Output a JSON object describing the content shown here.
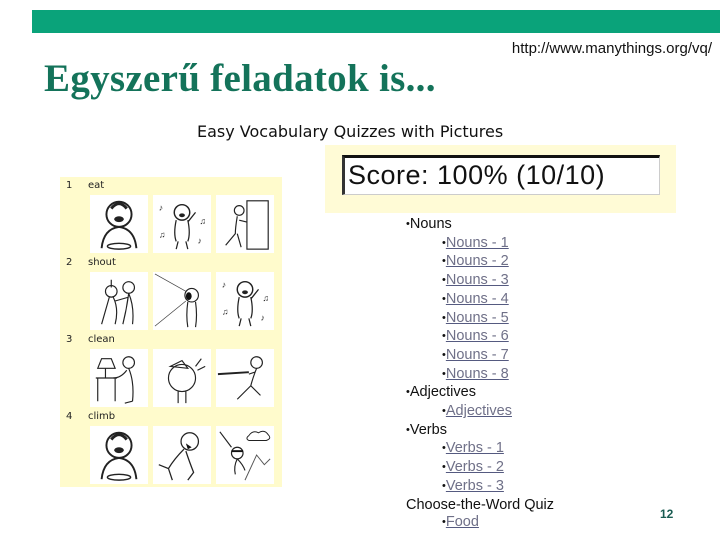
{
  "header": {
    "url": "http://www.manythings.org/vq/",
    "title": "Egyszerű feladatok is...",
    "subtitle": "Easy Vocabulary Quizzes with Pictures"
  },
  "colors": {
    "accent_bar": "#0aa37a",
    "title": "#14735a",
    "panel_bg": "#fffbcc",
    "link": "#6f7088"
  },
  "quiz": {
    "rows": [
      {
        "number": "1",
        "word": "eat",
        "pictures": [
          "eating-boy-icon",
          "singing-figure-icon",
          "pushing-door-icon"
        ]
      },
      {
        "number": "2",
        "word": "shout",
        "pictures": [
          "fighting-figures-icon",
          "shouting-figure-icon",
          "singing-figure-icon"
        ]
      },
      {
        "number": "3",
        "word": "clean",
        "pictures": [
          "cleaning-lamp-icon",
          "drinking-figure-icon",
          "pulling-rope-icon"
        ]
      },
      {
        "number": "4",
        "word": "climb",
        "pictures": [
          "eating-boy-icon",
          "falling-figure-icon",
          "climbing-mountain-icon"
        ]
      }
    ]
  },
  "score": {
    "text": "Score: 100% (10/10)",
    "percent": 100,
    "correct": 10,
    "total": 10
  },
  "links": {
    "bullet": "•",
    "groups": [
      {
        "label": "Nouns",
        "bulleted": true,
        "items": [
          "Nouns - 1",
          "Nouns - 2",
          "Nouns - 3",
          "Nouns - 4",
          "Nouns - 5",
          "Nouns - 6",
          "Nouns - 7",
          "Nouns - 8"
        ]
      },
      {
        "label": "Adjectives",
        "bulleted": true,
        "items": [
          "Adjectives"
        ]
      },
      {
        "label": "Verbs",
        "bulleted": true,
        "items": [
          "Verbs - 1",
          "Verbs - 2",
          "Verbs - 3"
        ]
      },
      {
        "label": "Choose-the-Word Quiz",
        "bulleted": false,
        "items": [
          "Food"
        ]
      }
    ]
  },
  "footer": {
    "page_number": "12"
  }
}
